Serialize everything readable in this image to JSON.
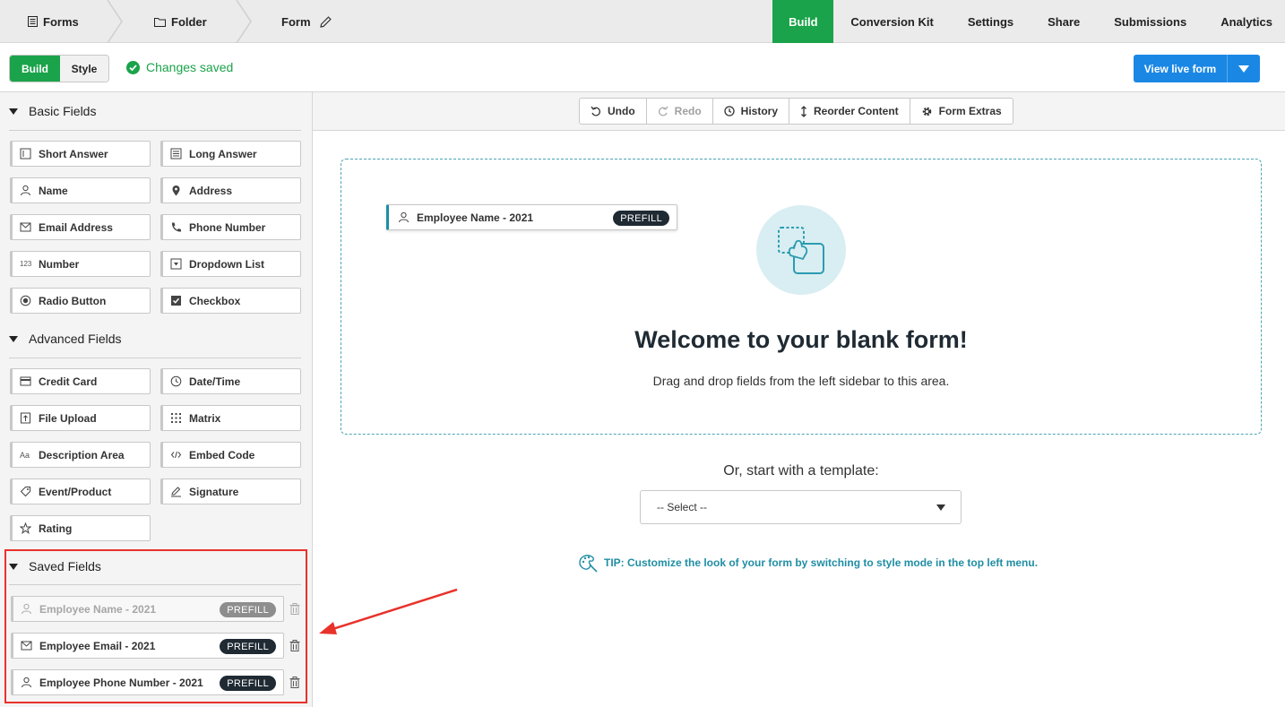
{
  "breadcrumb": {
    "forms": "Forms",
    "folder": "Folder",
    "form": "Form"
  },
  "tabs": [
    "Build",
    "Conversion Kit",
    "Settings",
    "Share",
    "Submissions",
    "Analytics"
  ],
  "mode": {
    "build": "Build",
    "style": "Style"
  },
  "status": "Changes saved",
  "view_live": "View live form",
  "sidebar": {
    "basic_title": "Basic Fields",
    "basic": [
      "Short Answer",
      "Long Answer",
      "Name",
      "Address",
      "Email Address",
      "Phone Number",
      "Number",
      "Dropdown List",
      "Radio Button",
      "Checkbox"
    ],
    "advanced_title": "Advanced Fields",
    "advanced": [
      "Credit Card",
      "Date/Time",
      "File Upload",
      "Matrix",
      "Description Area",
      "Embed Code",
      "Event/Product",
      "Signature",
      "Rating"
    ],
    "saved_title": "Saved Fields",
    "saved": [
      "Employee Name - 2021",
      "Employee Email - 2021",
      "Employee Phone Number - 2021"
    ],
    "prefill": "PREFILL",
    "number_icon_text": "123",
    "desc_icon_text": "Aa"
  },
  "toolbar": {
    "undo": "Undo",
    "redo": "Redo",
    "history": "History",
    "reorder": "Reorder Content",
    "extras": "Form Extras"
  },
  "canvas": {
    "drag_chip": "Employee Name - 2021",
    "welcome": "Welcome to your blank form!",
    "drag_hint": "Drag and drop fields from the left sidebar to this area.",
    "template_prompt": "Or, start with a template:",
    "select_value": "-- Select --",
    "tip_label": "TIP:",
    "tip_text": " Customize the look of your form by switching to style mode in the top left menu."
  },
  "colors": {
    "green": "#1aa34a",
    "blue": "#1b87e5",
    "teal": "#1f8ea3",
    "annotation_red": "#e8322b"
  }
}
